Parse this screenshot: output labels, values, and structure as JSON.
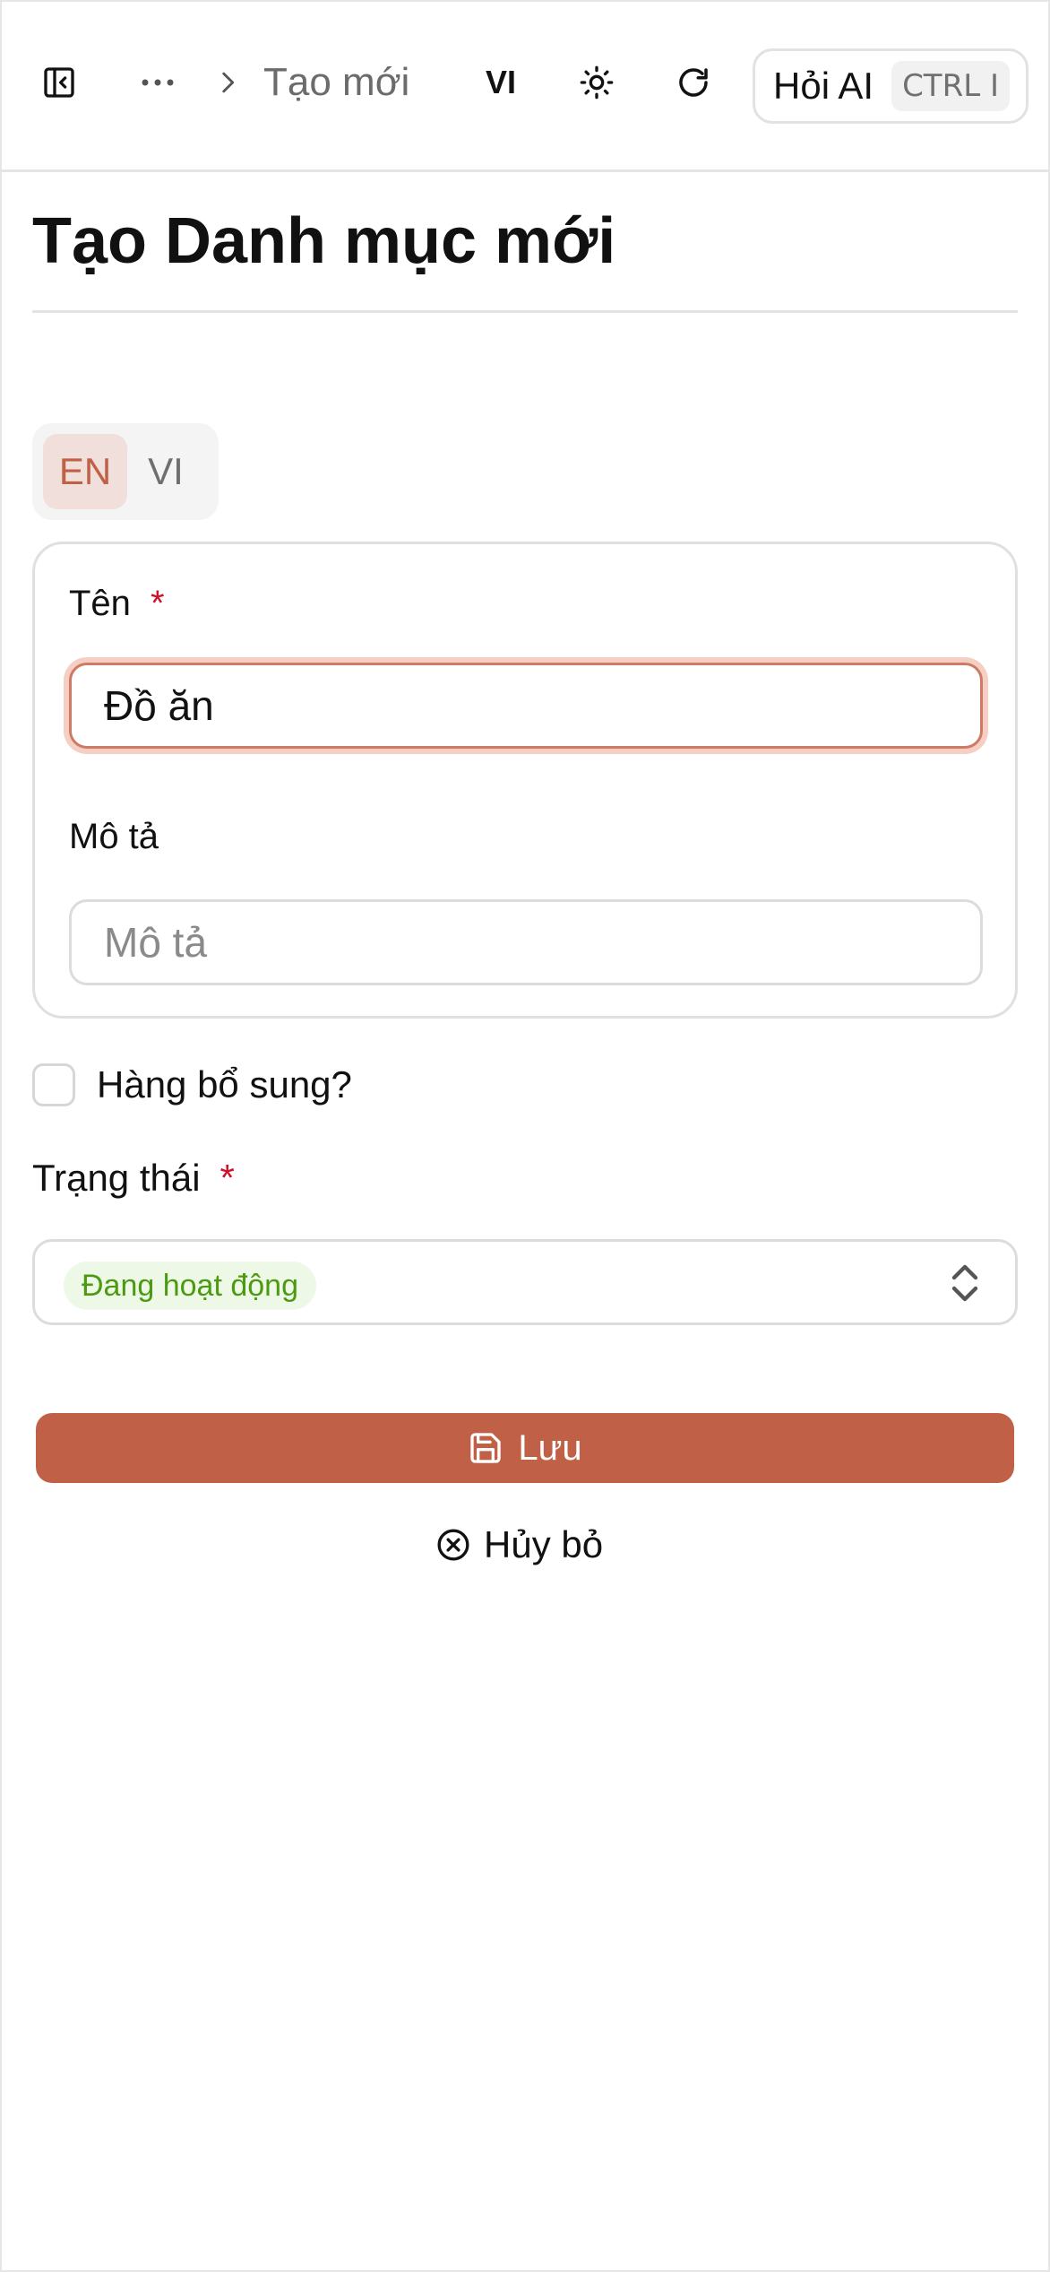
{
  "header": {
    "breadcrumb_current": "Tạo mới",
    "language": "VI",
    "ask_ai_label": "Hỏi AI",
    "ask_ai_shortcut": "CTRL I"
  },
  "page": {
    "title": "Tạo Danh mục mới"
  },
  "lang_tabs": [
    {
      "label": "EN",
      "active": true
    },
    {
      "label": "VI",
      "active": false
    }
  ],
  "form": {
    "name_label": "Tên",
    "required_mark": "*",
    "name_value": "Đồ ăn",
    "description_label": "Mô tả",
    "description_placeholder": "Mô tả",
    "description_value": "",
    "supplementary_label": "Hàng bổ sung?",
    "supplementary_checked": false,
    "status_label": "Trạng thái",
    "status_value": "Đang hoạt động"
  },
  "actions": {
    "save_label": "Lưu",
    "cancel_label": "Hủy bỏ"
  },
  "colors": {
    "accent": "#c06147",
    "status_active_bg": "#eef8e6",
    "status_active_text": "#4c9a12",
    "required": "#d0102a"
  },
  "icons": {
    "sidebar_toggle": "panel-left-close-icon",
    "more": "ellipsis-icon",
    "breadcrumb_separator": "chevron-right-icon",
    "theme": "sun-icon",
    "refresh": "refresh-icon",
    "select": "chevron-up-down-icon",
    "save": "floppy-disk-icon",
    "cancel": "circle-x-icon"
  }
}
